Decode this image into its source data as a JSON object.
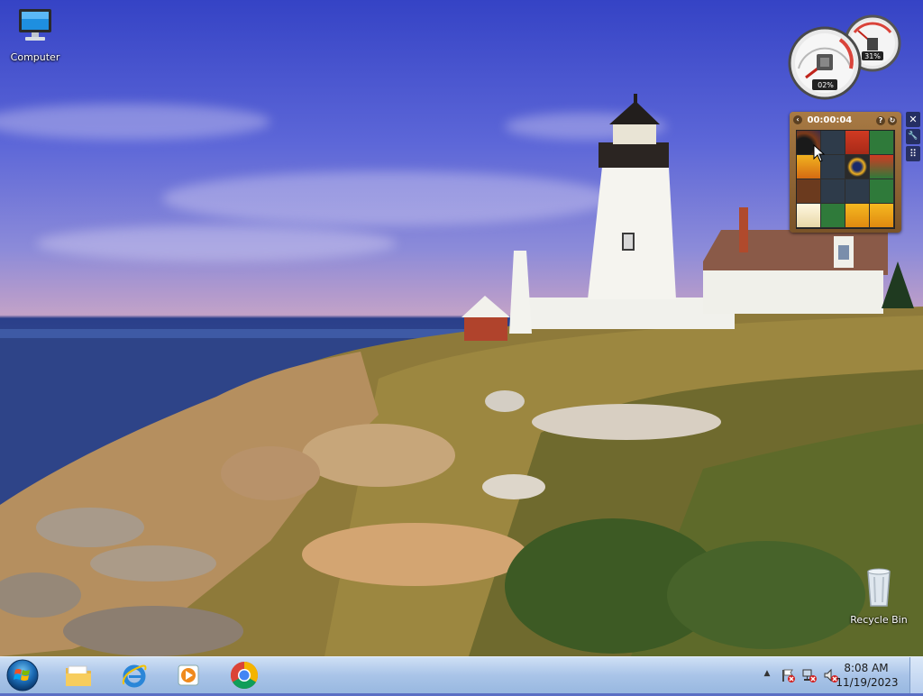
{
  "desktop": {
    "icons": [
      {
        "label": "Computer",
        "icon": "computer-icon"
      },
      {
        "label": "Recycle Bin",
        "icon": "recycle-bin-icon"
      }
    ]
  },
  "gadgets": {
    "cpu_meter": {
      "cpu_percent": "02%",
      "memory_percent": "31%",
      "cpu_value": 0.02,
      "memory_value": 0.31
    },
    "picture_puzzle": {
      "timer": "00:00:04"
    }
  },
  "gadget_controls": {
    "close": "✕",
    "options": "🔧",
    "drag": "⠿"
  },
  "taskbar": {
    "start": "start-orb",
    "pinned": [
      {
        "name": "Windows Explorer",
        "icon": "folder-icon"
      },
      {
        "name": "Internet Explorer",
        "icon": "ie-icon"
      },
      {
        "name": "Windows Media Player",
        "icon": "media-player-icon"
      },
      {
        "name": "Google Chrome",
        "icon": "chrome-icon"
      }
    ],
    "clock": {
      "time": "8:08 AM",
      "date": "11/19/2023"
    }
  },
  "colors": {
    "taskbar": "#a9c4e8",
    "sky_top": "#3543c5",
    "sea": "#2c3f80"
  }
}
